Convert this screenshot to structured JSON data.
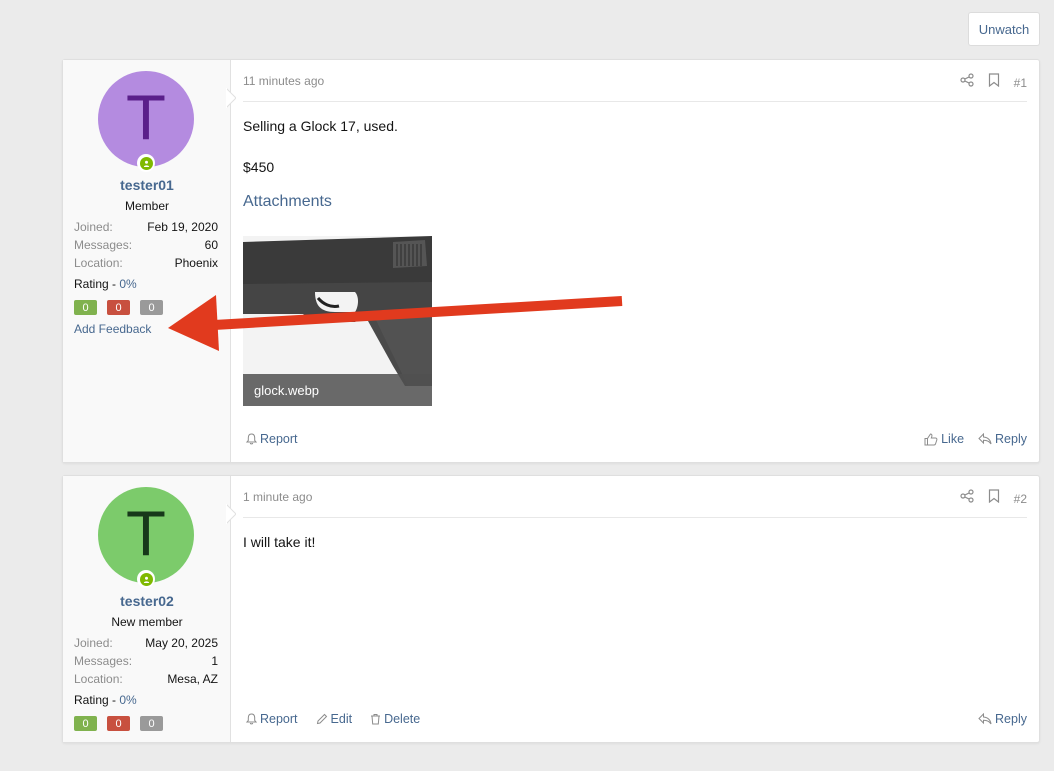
{
  "unwatch_label": "Unwatch",
  "posts": [
    {
      "avatar_letter": "T",
      "avatar_bg": "#b48be0",
      "avatar_fg": "#5a1f8a",
      "username": "tester01",
      "user_title": "Member",
      "stats": [
        {
          "label": "Joined:",
          "value": "Feb 19, 2020"
        },
        {
          "label": "Messages:",
          "value": "60"
        },
        {
          "label": "Location:",
          "value": "Phoenix"
        }
      ],
      "rating_label": "Rating -",
      "rating_value": "0%",
      "badges": [
        "0",
        "0",
        "0"
      ],
      "add_feedback": "Add Feedback",
      "time": "11 minutes ago",
      "post_number": "#1",
      "body_lines": [
        "Selling a Glock 17, used.",
        "$450"
      ],
      "attachments_title": "Attachments",
      "attachment_name": "glock.webp",
      "actions_left": [
        "Report"
      ],
      "actions_right": [
        "Like",
        "Reply"
      ]
    },
    {
      "avatar_letter": "T",
      "avatar_bg": "#7ccb6b",
      "avatar_fg": "#17381a",
      "username": "tester02",
      "user_title": "New member",
      "stats": [
        {
          "label": "Joined:",
          "value": "May 20, 2025"
        },
        {
          "label": "Messages:",
          "value": "1"
        },
        {
          "label": "Location:",
          "value": "Mesa, AZ"
        }
      ],
      "rating_label": "Rating -",
      "rating_value": "0%",
      "badges": [
        "0",
        "0",
        "0"
      ],
      "time": "1 minute ago",
      "post_number": "#2",
      "body_lines": [
        "I will take it!"
      ],
      "actions_left": [
        "Report",
        "Edit",
        "Delete"
      ],
      "actions_right": [
        "Reply"
      ]
    }
  ],
  "colors": {
    "link": "#47688f",
    "badge_positive": "#80b24e",
    "badge_negative": "#c8503f",
    "badge_neutral": "#9a9a9a",
    "annotation_arrow": "#e13a1e"
  }
}
